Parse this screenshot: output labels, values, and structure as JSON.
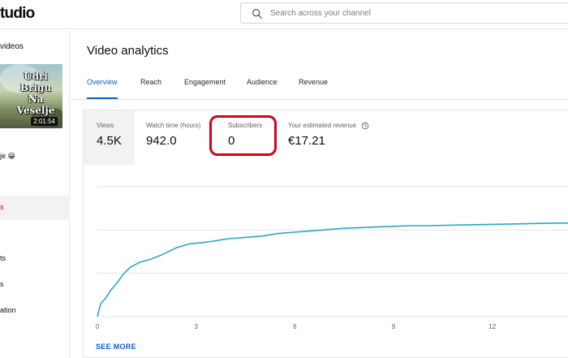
{
  "header": {
    "brand_text": "tudio",
    "search_placeholder": "Search across your channel",
    "search_value": ""
  },
  "sidebar": {
    "back_label": "videos",
    "thumbnail": {
      "title": "Udri\nBrigu\nNa\nVeselje",
      "duration": "2:01:54"
    },
    "video_subtitle": "je 😀",
    "active_item": "s",
    "items": [
      "ts",
      "s",
      "ation"
    ]
  },
  "main": {
    "title": "Video analytics",
    "tabs": [
      "Overview",
      "Reach",
      "Engagement",
      "Audience",
      "Revenue"
    ],
    "active_tab": "Overview",
    "metrics": [
      {
        "label": "Views",
        "value": "4.5K"
      },
      {
        "label": "Watch time (hours)",
        "value": "942.0"
      },
      {
        "label": "Subscribers",
        "value": "0"
      },
      {
        "label": "Your estimated revenue",
        "value": "€17.21"
      }
    ],
    "see_more": "SEE MORE"
  },
  "colors": {
    "accent": "#065fd4",
    "line": "#2ba8bd",
    "highlight": "#d6001c",
    "active_nav": "#cc0000"
  },
  "chart_data": {
    "type": "line",
    "x_ticks": [
      "0",
      "3",
      "6",
      "9",
      "12"
    ],
    "xlim": [
      0,
      14.3
    ],
    "ylim": [
      0,
      1
    ],
    "grid": true,
    "series": [
      {
        "x": [
          0,
          0.1,
          0.25,
          0.4,
          0.6,
          0.8,
          1.0,
          1.3,
          1.6,
          2.0,
          2.4,
          2.8,
          3.2,
          3.5,
          4.0,
          4.5,
          5.0,
          5.5,
          6.0,
          6.5,
          7.0,
          7.5,
          8.0,
          8.5,
          9.0,
          9.5,
          10.0,
          11.0,
          12.0,
          13.0,
          14.0,
          14.3
        ],
        "y": [
          0.0,
          0.1,
          0.14,
          0.2,
          0.26,
          0.33,
          0.38,
          0.42,
          0.44,
          0.48,
          0.53,
          0.56,
          0.57,
          0.58,
          0.6,
          0.61,
          0.62,
          0.64,
          0.65,
          0.66,
          0.67,
          0.68,
          0.685,
          0.69,
          0.695,
          0.7,
          0.7,
          0.705,
          0.71,
          0.715,
          0.72,
          0.72
        ]
      }
    ]
  }
}
